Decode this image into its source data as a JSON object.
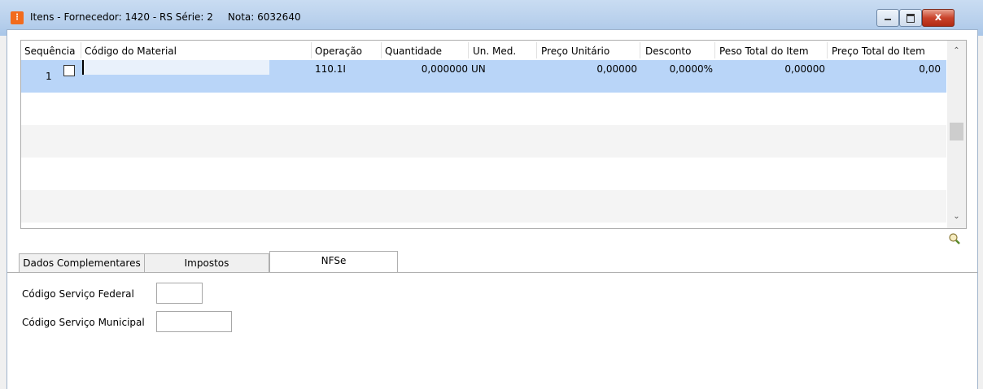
{
  "window": {
    "title_parts": [
      "Itens - Fornecedor: 1420 - RS Série: 2",
      "Nota: 6032640"
    ],
    "close_label": "x",
    "app_icon": "grid-app-icon"
  },
  "grid": {
    "columns": [
      "Sequência",
      "Código do Material",
      "Operação",
      "Quantidade",
      "Un. Med.",
      "Preço Unitário",
      "Desconto",
      "Peso Total do Item",
      "Preço Total do Item"
    ],
    "rows": [
      {
        "sequencia": "1",
        "checked": false,
        "codigo": "",
        "operacao": "110.1I",
        "quantidade": "0,000000",
        "un_med": "UN",
        "preco_unitario": "0,00000",
        "desconto": "0,0000%",
        "peso_total": "0,00000",
        "preco_total": "0,00"
      }
    ],
    "selected_row_color": "#b9d5f8"
  },
  "tabs": {
    "items": [
      {
        "label": "Dados Complementares",
        "active": false
      },
      {
        "label": "Impostos",
        "active": false
      },
      {
        "label": "NFSe",
        "active": true
      }
    ]
  },
  "nfse": {
    "federal_label": "Código Serviço Federal",
    "federal_value": "",
    "municipal_label": "Código Serviço Municipal",
    "municipal_value": ""
  }
}
